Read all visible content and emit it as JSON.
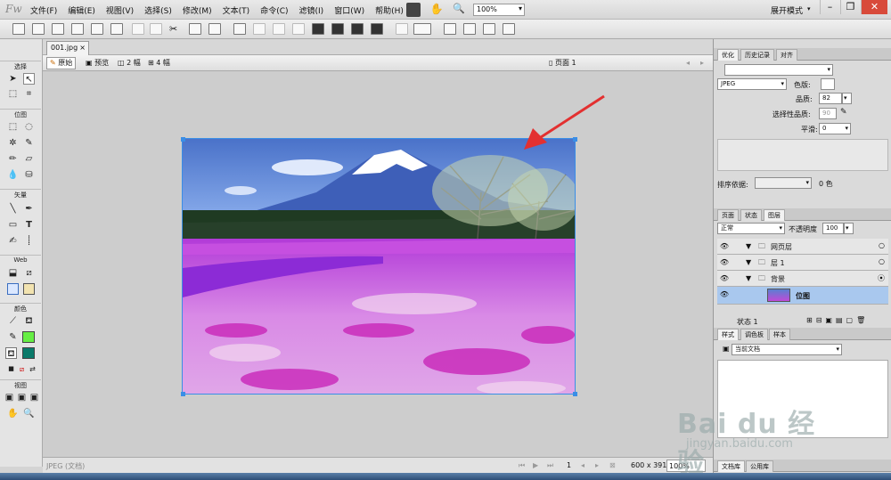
{
  "app": {
    "logo": "Fw"
  },
  "menu": [
    "文件(F)",
    "编辑(E)",
    "视图(V)",
    "选择(S)",
    "修改(M)",
    "文本(T)",
    "命令(C)",
    "滤镜(I)",
    "窗口(W)",
    "帮助(H)"
  ],
  "topbar": {
    "zoom": "100%",
    "layout_mode": "展开模式"
  },
  "tools": {
    "sections": [
      "选择",
      "位图",
      "矢量",
      "Web",
      "颜色",
      "视图"
    ]
  },
  "document": {
    "tab_name": "001.jpg",
    "views": {
      "original": "原始",
      "preview": "预览",
      "two_up": "2 幅",
      "four_up": "4 幅"
    },
    "page_label": "页面 1"
  },
  "status": {
    "doc_type": "JPEG (文档)",
    "frame": "1",
    "size": "600 x 391",
    "zoom": "100%"
  },
  "optimize_panel": {
    "tabs": [
      "优化",
      "历史记录",
      "对齐"
    ],
    "format": "JPEG",
    "matte_label": "色版:",
    "quality_label": "品质:",
    "quality_value": "82",
    "selective_label": "选择性品质:",
    "selective_value": "90",
    "smoothing_label": "平滑:",
    "smoothing_value": "0",
    "sort_label": "排序依据:",
    "colors_count": "0 色"
  },
  "layers_panel": {
    "tabs": [
      "页面",
      "状态",
      "图层"
    ],
    "blend_mode": "正常",
    "opacity_label": "不透明度",
    "opacity_value": "100",
    "layers": [
      {
        "name": "网页层"
      },
      {
        "name": "层 1"
      },
      {
        "name": "背景"
      },
      {
        "name": "位图"
      }
    ],
    "state_label": "状态 1"
  },
  "styles_panel": {
    "tabs": [
      "样式",
      "调色板",
      "样本"
    ],
    "library": "当前文档"
  },
  "bottom_tabs": [
    "文档库",
    "公用库"
  ],
  "watermark": {
    "text": "Bai du 经验",
    "url": "jingyan.baidu.com"
  },
  "colors": {
    "accent": "#3a8ee6",
    "fill": "#66ee44",
    "stroke": "#0a7a6a",
    "arrow": "#e33030"
  }
}
